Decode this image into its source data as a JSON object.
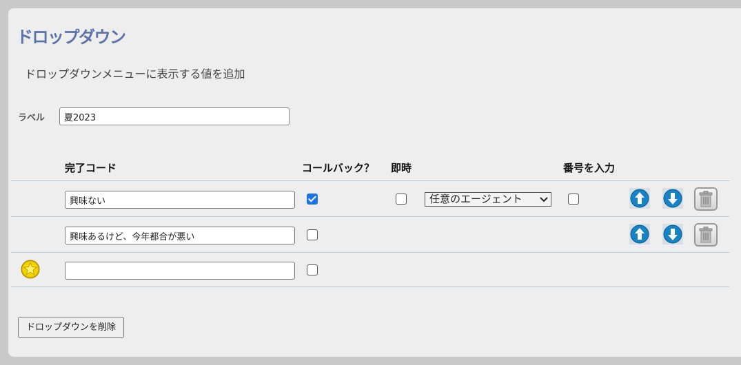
{
  "page": {
    "title": "ドロップダウン",
    "subtitle": "ドロップダウンメニューに表示する値を追加"
  },
  "label_field": {
    "label": "ラベル",
    "value": "夏2023"
  },
  "table": {
    "headers": {
      "code": "完了コード",
      "callback": "コールバック？",
      "immediate": "即時",
      "enter_number": "番号を入力"
    },
    "rows": [
      {
        "code": "興味ない",
        "callback": true,
        "immediate": false,
        "agent": "任意のエージェント",
        "enter_number": false
      },
      {
        "code": "興味あるけど、今年都合が悪い",
        "callback": false
      },
      {
        "code": "",
        "callback": false
      }
    ]
  },
  "buttons": {
    "delete_dropdown": "ドロップダウンを削除"
  },
  "icons": {
    "up": "arrow-up-icon",
    "down": "arrow-down-icon",
    "delete": "trash-icon",
    "new_row": "star-icon"
  },
  "colors": {
    "title": "#5b73a8",
    "checkbox_checked": "#1a73e8",
    "arrow_button": "#1583c4",
    "star": "#f5d400"
  }
}
